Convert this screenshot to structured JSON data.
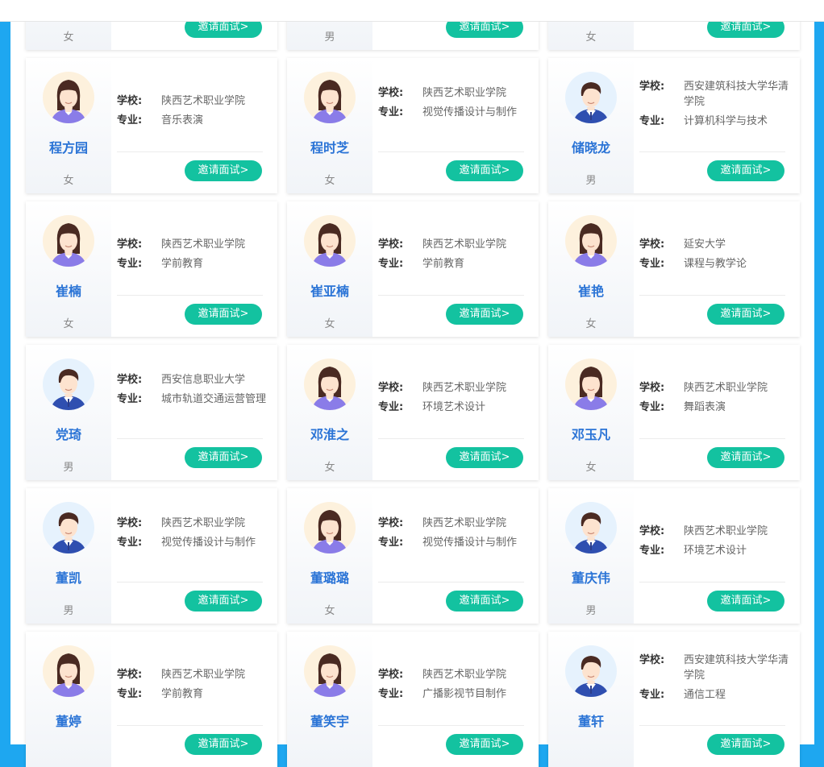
{
  "header": {
    "title": ""
  },
  "labels": {
    "school": "学校:",
    "major": "专业:",
    "invite": "邀请面试>"
  },
  "colors": {
    "accent": "#13c2a0",
    "name": "#2b74d6",
    "frame": "#1ea7f0"
  },
  "top_row": [
    {
      "gender": "女"
    },
    {
      "gender": "男"
    },
    {
      "gender": "女"
    }
  ],
  "candidates": [
    {
      "name": "程方园",
      "gender": "女",
      "school": "陕西艺术职业学院",
      "major": "音乐表演",
      "avatar": "female-avatar-icon"
    },
    {
      "name": "程时芝",
      "gender": "女",
      "school": "陕西艺术职业学院",
      "major": "视觉传播设计与制作",
      "avatar": "female-avatar-icon"
    },
    {
      "name": "储晓龙",
      "gender": "男",
      "school": "西安建筑科技大学华清学院",
      "major": "计算机科学与技术",
      "avatar": "male-avatar-icon"
    },
    {
      "name": "崔楠",
      "gender": "女",
      "school": "陕西艺术职业学院",
      "major": "学前教育",
      "avatar": "female-avatar-icon"
    },
    {
      "name": "崔亚楠",
      "gender": "女",
      "school": "陕西艺术职业学院",
      "major": "学前教育",
      "avatar": "female-avatar-icon"
    },
    {
      "name": "崔艳",
      "gender": "女",
      "school": "延安大学",
      "major": "课程与教学论",
      "avatar": "female-avatar-icon"
    },
    {
      "name": "党琦",
      "gender": "男",
      "school": "西安信息职业大学",
      "major": "城市轨道交通运营管理",
      "avatar": "male-avatar-icon"
    },
    {
      "name": "邓淮之",
      "gender": "女",
      "school": "陕西艺术职业学院",
      "major": "环境艺术设计",
      "avatar": "female-avatar-icon"
    },
    {
      "name": "邓玉凡",
      "gender": "女",
      "school": "陕西艺术职业学院",
      "major": "舞蹈表演",
      "avatar": "female-avatar-icon"
    },
    {
      "name": "董凯",
      "gender": "男",
      "school": "陕西艺术职业学院",
      "major": "视觉传播设计与制作",
      "avatar": "male-avatar-icon"
    },
    {
      "name": "董璐璐",
      "gender": "女",
      "school": "陕西艺术职业学院",
      "major": "视觉传播设计与制作",
      "avatar": "female-avatar-icon"
    },
    {
      "name": "董庆伟",
      "gender": "男",
      "school": "陕西艺术职业学院",
      "major": "环境艺术设计",
      "avatar": "male-avatar-icon"
    },
    {
      "name": "董婷",
      "gender": "",
      "school": "陕西艺术职业学院",
      "major": "学前教育",
      "avatar": "female-avatar-icon"
    },
    {
      "name": "董笑宇",
      "gender": "",
      "school": "陕西艺术职业学院",
      "major": "广播影视节目制作",
      "avatar": "female-avatar-icon"
    },
    {
      "name": "董轩",
      "gender": "",
      "school": "西安建筑科技大学华清学院",
      "major": "通信工程",
      "avatar": "male-avatar-icon"
    }
  ]
}
